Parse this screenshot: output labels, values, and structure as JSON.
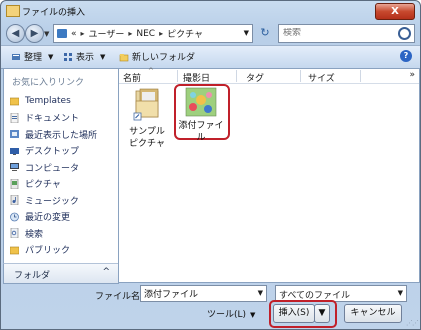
{
  "window": {
    "title": "ファイルの挿入",
    "close_label": "X"
  },
  "address": {
    "prefix": "«",
    "crumbs": [
      "ユーザー",
      "NEC",
      "ピクチャ"
    ],
    "separator": "▸"
  },
  "search": {
    "placeholder": "検索"
  },
  "toolbar": {
    "organize": "整理",
    "views": "表示",
    "new_folder": "新しいフォルダ"
  },
  "nav": {
    "header": "お気に入りリンク",
    "items": [
      {
        "label": "Templates",
        "icon": "folder-icon"
      },
      {
        "label": "ドキュメント",
        "icon": "documents-icon"
      },
      {
        "label": "最近表示した場所",
        "icon": "recent-places-icon"
      },
      {
        "label": "デスクトップ",
        "icon": "desktop-icon"
      },
      {
        "label": "コンピュータ",
        "icon": "computer-icon"
      },
      {
        "label": "ピクチャ",
        "icon": "pictures-icon"
      },
      {
        "label": "ミュージック",
        "icon": "music-icon"
      },
      {
        "label": "最近の変更",
        "icon": "recent-changes-icon"
      },
      {
        "label": "検索",
        "icon": "search-folder-icon"
      },
      {
        "label": "パブリック",
        "icon": "public-folder-icon"
      }
    ],
    "folders_label": "フォルダ",
    "folders_caret": "^"
  },
  "columns": [
    "名前",
    "撮影日",
    "タグ",
    "サイズ"
  ],
  "more_columns": "»",
  "files": [
    {
      "name_line1": "サンプル",
      "name_line2": "ピクチャ",
      "icon": "sample-pictures-folder-icon"
    },
    {
      "name_line1": "添付ファイル",
      "name_line2": "",
      "icon": "image-file-icon"
    }
  ],
  "bottom": {
    "filename_label": "ファイル名(N):",
    "filename_value": "添付ファイル",
    "filter_value": "すべてのファイル",
    "tools_label": "ツール(L)",
    "insert_label": "挿入(S)",
    "cancel_label": "キャンセル"
  },
  "colors": {
    "highlight": "#c0202a",
    "window_frame": "#b9cfe8"
  }
}
